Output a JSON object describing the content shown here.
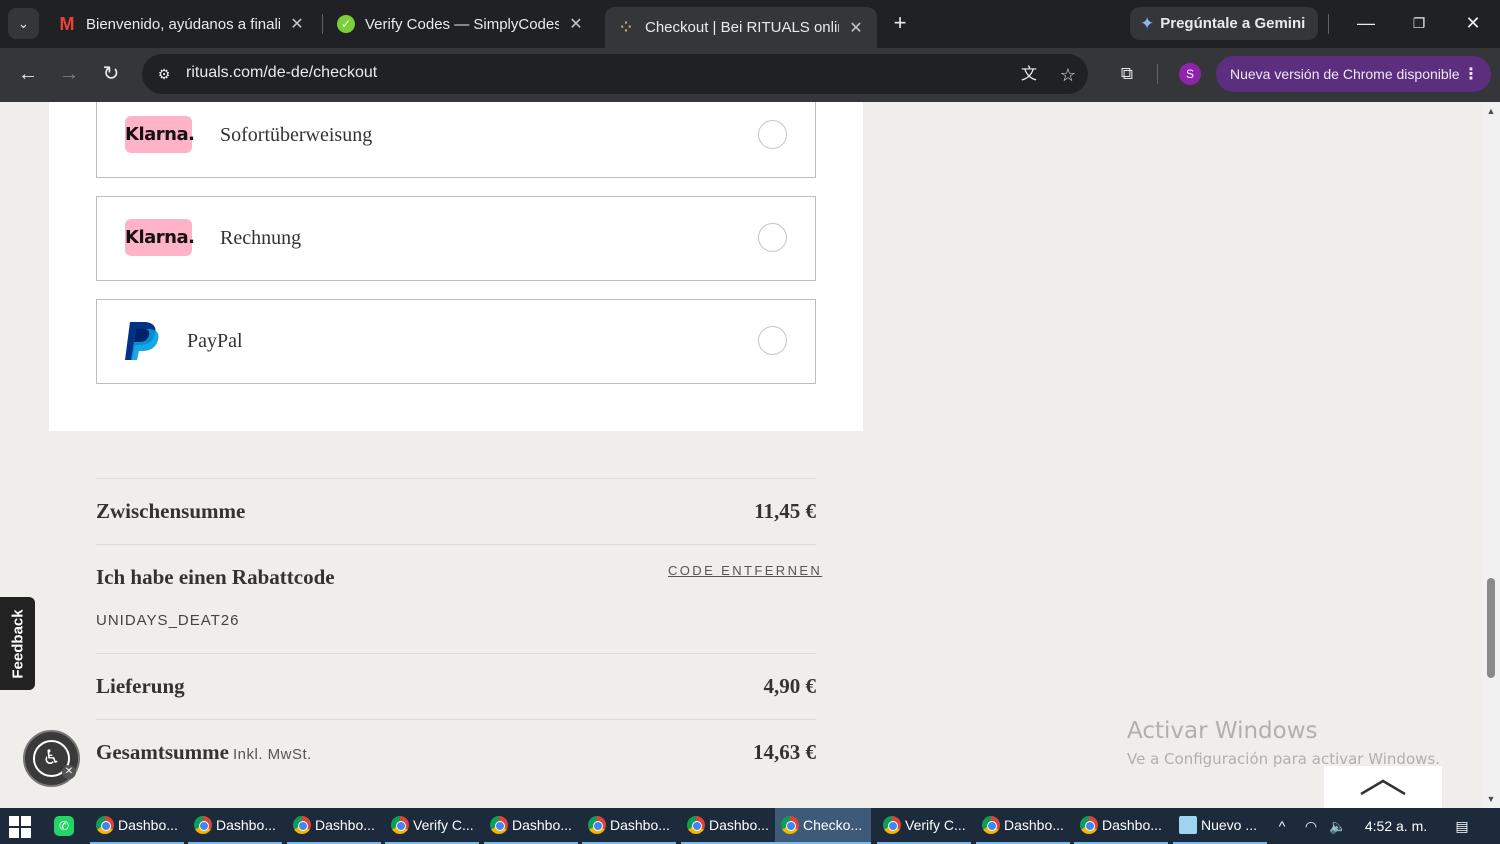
{
  "browser": {
    "tabs": [
      {
        "title": "Bienvenido, ayúdanos a finaliza",
        "favicon": "gmail-icon",
        "active": false
      },
      {
        "title": "Verify Codes — SimplyCodes",
        "favicon": "simplycodes-icon",
        "active": false
      },
      {
        "title": "Checkout | Bei RITUALS online b",
        "favicon": "rituals-icon",
        "active": true
      }
    ],
    "new_tab": "+",
    "gemini_label": "Pregúntale a Gemini",
    "url": "rituals.com/de-de/checkout",
    "profile_initial": "S",
    "update_label": "Nueva versión de Chrome disponible"
  },
  "payment": {
    "options": [
      {
        "logo": "Klarna.",
        "label": "Sofortüberweisung"
      },
      {
        "logo": "Klarna.",
        "label": "Rechnung"
      },
      {
        "logo": "paypal-icon",
        "label": "PayPal"
      }
    ]
  },
  "summary": {
    "subtotal_label": "Zwischensumme",
    "subtotal_value": "11,45 €",
    "discount_label": "Ich habe einen Rabattcode",
    "discount_remove": "CODE ENTFERNEN",
    "discount_code": "UNIDAYS_DEAT26",
    "delivery_label": "Lieferung",
    "delivery_value": "4,90 €",
    "total_label": "Gesamtsumme",
    "total_note": "Inkl. MwSt.",
    "total_value": "14,63 €"
  },
  "overlay": {
    "feedback_label": "Feedback",
    "windows_title": "Activar Windows",
    "windows_sub": "Ve a Configuración para activar Windows."
  },
  "taskbar": {
    "items": [
      {
        "label": "Dashbo...",
        "icon": "chrome-icon",
        "active": false
      },
      {
        "label": "Dashbo...",
        "icon": "chrome-icon",
        "active": false
      },
      {
        "label": "Dashbo...",
        "icon": "chrome-icon",
        "active": false
      },
      {
        "label": "Verify C...",
        "icon": "chrome-icon",
        "active": false
      },
      {
        "label": "Dashbo...",
        "icon": "chrome-icon",
        "active": false
      },
      {
        "label": "Dashbo...",
        "icon": "chrome-icon",
        "active": false
      },
      {
        "label": "Dashbo...",
        "icon": "chrome-icon",
        "active": false
      },
      {
        "label": "Checko...",
        "icon": "chrome-icon",
        "active": true
      },
      {
        "label": "Verify C...",
        "icon": "chrome-icon",
        "active": false
      },
      {
        "label": "Dashbo...",
        "icon": "chrome-icon",
        "active": false
      },
      {
        "label": "Dashbo...",
        "icon": "chrome-icon",
        "active": false
      },
      {
        "label": "Nuevo ...",
        "icon": "notepad-icon",
        "active": false
      }
    ],
    "clock": "4:52 a. m."
  },
  "colors": {
    "klarna_pink": "#ffb3c7",
    "paypal_dark": "#003087",
    "paypal_light": "#009cde",
    "update_chip": "#5c2e7e"
  }
}
